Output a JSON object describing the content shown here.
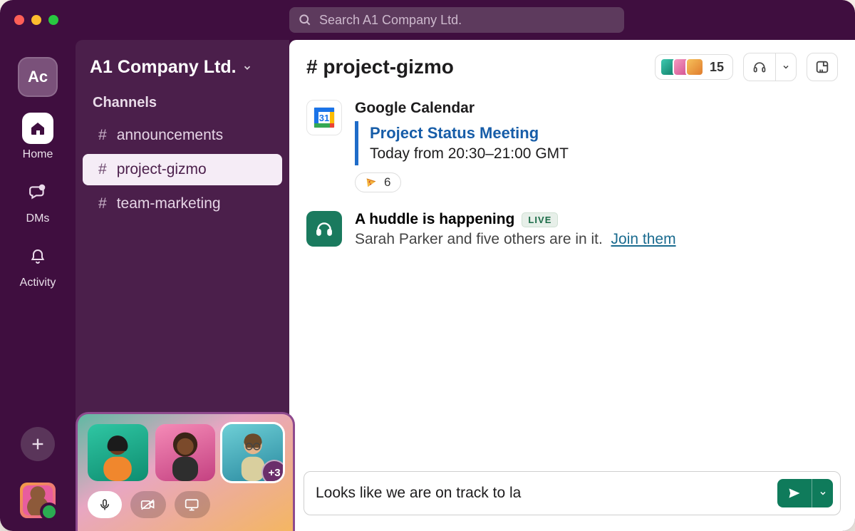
{
  "search": {
    "placeholder": "Search A1 Company Ltd."
  },
  "workspace": {
    "badge": "Ac",
    "name": "A1 Company Ltd."
  },
  "rail": {
    "home": "Home",
    "dms": "DMs",
    "activity": "Activity"
  },
  "sidebar": {
    "section": "Channels",
    "channels": [
      {
        "name": "announcements"
      },
      {
        "name": "project-gizmo"
      },
      {
        "name": "team-marketing"
      }
    ]
  },
  "huddle_widget": {
    "overflow": "+3"
  },
  "channel": {
    "name": "# project-gizmo",
    "member_count": "15"
  },
  "messages": {
    "calendar": {
      "app": "Google Calendar",
      "day_number": "31",
      "title": "Project Status Meeting",
      "time": "Today from 20:30–21:00 GMT",
      "reaction_count": "6"
    },
    "huddle": {
      "title": "A huddle is happening",
      "live": "LIVE",
      "sub": "Sarah Parker and five others are in it.",
      "join": "Join them"
    }
  },
  "composer": {
    "value": "Looks like we are on track to la"
  }
}
